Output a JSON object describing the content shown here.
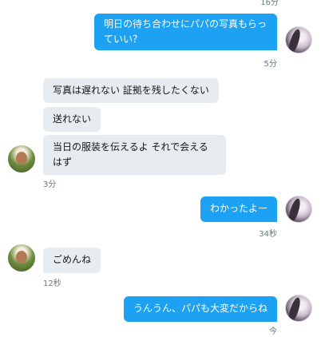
{
  "messages": [
    {
      "text": "明日の待ち合わせにパパの写真もらっていい？"
    },
    {
      "text": "写真は遅れない 証拠を残したくない"
    },
    {
      "text": "送れない"
    },
    {
      "text": "当日の服装を伝えるよ それで会えるはず"
    },
    {
      "text": "わかったよー"
    },
    {
      "text": "ごめんね"
    },
    {
      "text": "うんうん、パパも大変だからね"
    }
  ],
  "timestamps": {
    "top_partial": "16分",
    "t1": "5分",
    "t2": "3分",
    "t3": "34秒",
    "t4": "12秒",
    "t5": "今"
  }
}
